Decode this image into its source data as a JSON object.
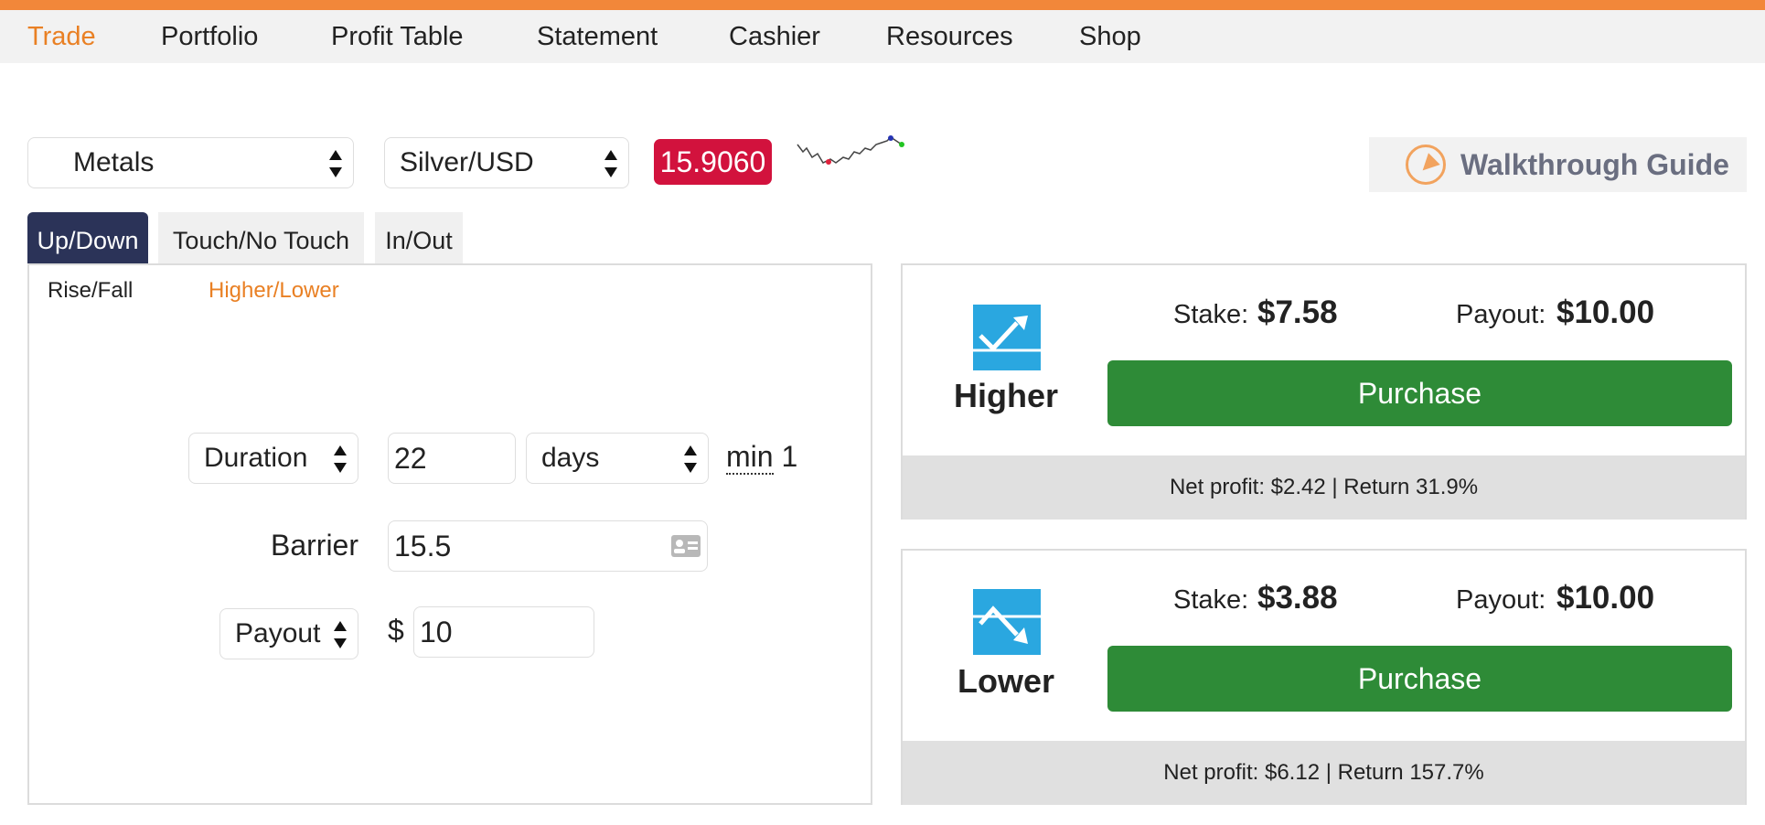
{
  "nav": {
    "items": [
      "Trade",
      "Portfolio",
      "Profit Table",
      "Statement",
      "Cashier",
      "Resources",
      "Shop"
    ]
  },
  "market": {
    "category": "Metals",
    "symbol": "Silver/USD",
    "price": "15.9060"
  },
  "walkthrough_label": "Walkthrough Guide",
  "contract_tabs": [
    "Up/Down",
    "Touch/No Touch",
    "In/Out"
  ],
  "sub_tabs": [
    "Rise/Fall",
    "Higher/Lower"
  ],
  "form": {
    "duration_select": "Duration",
    "duration_value": "22",
    "duration_unit": "days",
    "min_abbr": "min",
    "min_value": "1",
    "barrier_label": "Barrier",
    "barrier_value": "15.5",
    "payout_select": "Payout",
    "currency": "$",
    "payout_value": "10"
  },
  "higher": {
    "label": "Higher",
    "stake_label": "Stake:",
    "stake": "$7.58",
    "payout_label": "Payout:",
    "payout": "$10.00",
    "purchase": "Purchase",
    "footer": "Net profit: $2.42 | Return 31.9%"
  },
  "lower": {
    "label": "Lower",
    "stake_label": "Stake:",
    "stake": "$3.88",
    "payout_label": "Payout:",
    "payout": "$10.00",
    "purchase": "Purchase",
    "footer": "Net profit: $6.12 | Return 157.7%"
  },
  "colors": {
    "accent": "#e98024",
    "price_badge": "#d2123d",
    "active_tab": "#2b3358",
    "purchase": "#2e8b37",
    "icon_bg": "#2aa7e0"
  }
}
